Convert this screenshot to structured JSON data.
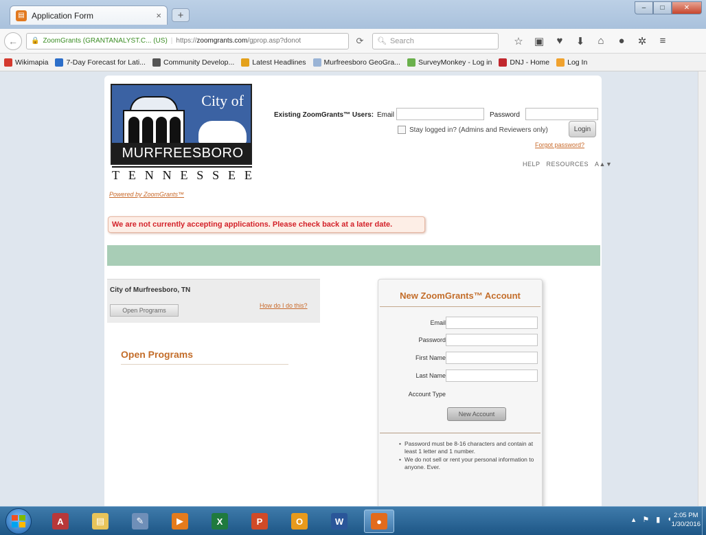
{
  "browser": {
    "tab_title": "Application Form",
    "tab_close": "×",
    "new_tab": "+",
    "url_identity": "ZoomGrants (GRANTANALYST.C... (US)",
    "url_prefix": "https://",
    "url_domain": "zoomgrants.com",
    "url_path": "/gprop.asp?donot",
    "search_placeholder": "Search",
    "window_minimize": "–",
    "window_maximize": "□",
    "window_close": "✕"
  },
  "bookmarks": [
    {
      "label": "Wikimapia",
      "color": "#d43a2f"
    },
    {
      "label": "7-Day Forecast for Lati...",
      "color": "#2c6ec9"
    },
    {
      "label": "Community Develop...",
      "color": "#555555"
    },
    {
      "label": "Latest Headlines",
      "color": "#e4a11b"
    },
    {
      "label": "Murfreesboro GeoGra...",
      "color": "#9ab4d6"
    },
    {
      "label": "SurveyMonkey - Log in",
      "color": "#6ab04c"
    },
    {
      "label": "DNJ - Home",
      "color": "#c1272d"
    },
    {
      "label": "Log In",
      "color": "#f0a22e"
    }
  ],
  "logo": {
    "city_of": "City of",
    "name": "MURFREESBORO",
    "state_letters": [
      "T",
      "E",
      "N",
      "N",
      "E",
      "S",
      "S",
      "E",
      "E"
    ],
    "powered_by": "Powered by ZoomGrants™"
  },
  "login": {
    "label": "Existing ZoomGrants™ Users:",
    "email_label": "Email",
    "password_label": "Password",
    "stay_logged_in": "Stay logged in? (Admins and Reviewers only)",
    "login_button": "Login",
    "forgot_password": "Forgot password?",
    "help": "HELP",
    "resources": "RESOURCES",
    "text_size": "A▲▼"
  },
  "alert": {
    "message": "We are not currently accepting applications. Please check back at a later date."
  },
  "organization": {
    "name": "City of Murfreesboro, TN",
    "open_programs_button": "Open Programs",
    "how_do_i_do_this": "How do I do this?"
  },
  "open_programs": {
    "heading": "Open Programs"
  },
  "new_account": {
    "title": "New ZoomGrants™ Account",
    "email_label": "Email",
    "password_label": "Password",
    "first_name_label": "First Name",
    "last_name_label": "Last Name",
    "account_type_label": "Account Type",
    "button": "New Account",
    "notes": [
      "Password must be 8-16 characters and contain at least 1 letter and 1 number.",
      "We do not sell or rent your personal information to anyone. Ever."
    ]
  },
  "taskbar": {
    "apps": [
      {
        "name": "Access",
        "color": "#b8383a",
        "glyph": "A"
      },
      {
        "name": "File Explorer",
        "color": "#e8c45a",
        "glyph": "▤"
      },
      {
        "name": "Paint",
        "color": "#6f8fb8",
        "glyph": "✎"
      },
      {
        "name": "Media Player",
        "color": "#e47b1c",
        "glyph": "▶"
      },
      {
        "name": "Excel",
        "color": "#1f7a3e",
        "glyph": "X"
      },
      {
        "name": "PowerPoint",
        "color": "#d04a27",
        "glyph": "P"
      },
      {
        "name": "Outlook",
        "color": "#e89a1c",
        "glyph": "O"
      },
      {
        "name": "Word",
        "color": "#2a5699",
        "glyph": "W"
      },
      {
        "name": "Firefox",
        "color": "#e26b1c",
        "glyph": "●"
      }
    ],
    "time": "2:05 PM",
    "date": "1/30/2016"
  }
}
